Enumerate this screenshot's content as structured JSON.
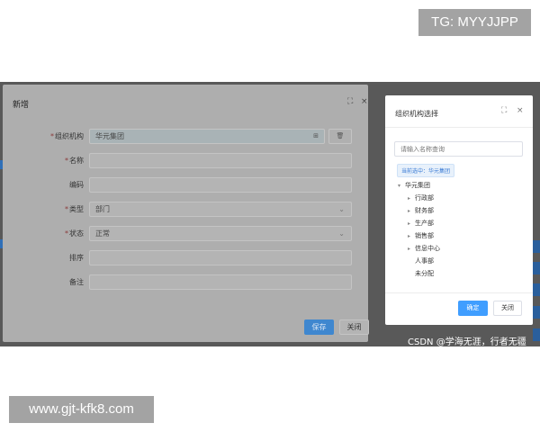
{
  "watermarks": {
    "top": "TG: MYYJJPP",
    "bottom": "www.gjt-kfk8.com"
  },
  "dialog": {
    "title": "新增",
    "fields": {
      "org": {
        "label": "组织机构",
        "value": "华元集团"
      },
      "name": {
        "label": "名称"
      },
      "code": {
        "label": "编码"
      },
      "type": {
        "label": "类型",
        "value": "部门"
      },
      "status": {
        "label": "状态",
        "value": "正常"
      },
      "sort": {
        "label": "排序"
      },
      "remark": {
        "label": "备注"
      }
    },
    "save_label": "保存",
    "close_label": "关闭"
  },
  "picker": {
    "title": "组织机构选择",
    "search_placeholder": "请输入名称查询",
    "selected": "当前选中：华元集团",
    "tree": {
      "root": "华元集团",
      "children": [
        "行政部",
        "财务部",
        "生产部",
        "销售部",
        "信息中心",
        "人事部",
        "未分配"
      ]
    },
    "ok_label": "确定",
    "close_label": "关闭"
  },
  "credit": "CSDN @学海无涯，行者无疆",
  "colors": {
    "primary": "#409eff",
    "overlay": "#595959"
  },
  "icons": {
    "maximize": "⛶",
    "close": "×",
    "tree_expanded": "▾",
    "tree_collapsed": "▸"
  }
}
